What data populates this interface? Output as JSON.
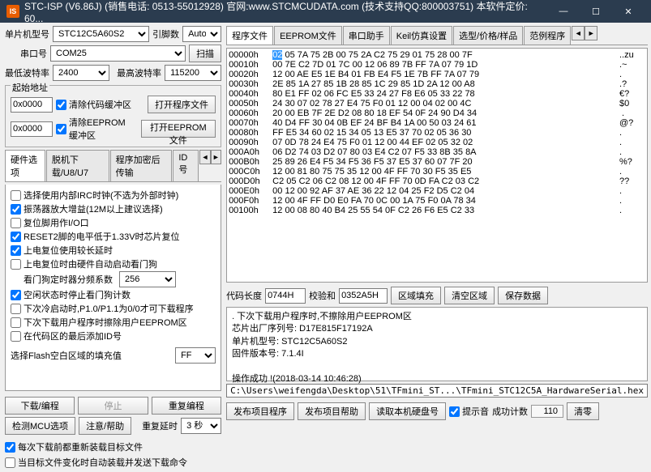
{
  "titlebar": {
    "text": "STC-ISP (V6.86J) (销售电话: 0513-55012928) 官网:www.STCMCUDATA.com (技术支持QQ:800003751) 本软件定价: 60..."
  },
  "left": {
    "mcu_label": "单片机型号",
    "mcu_value": "STC12C5A60S2",
    "pins_label": "引脚数",
    "pins_value": "Auto",
    "port_label": "串口号",
    "port_value": "COM25",
    "scan_btn": "扫描",
    "minbaud_label": "最低波特率",
    "minbaud_value": "2400",
    "maxbaud_label": "最高波特率",
    "maxbaud_value": "115200",
    "start_addr_title": "起始地址",
    "addr1": "0x0000",
    "clear_code": "清除代码缓冲区",
    "open_code": "打开程序文件",
    "addr2": "0x0000",
    "clear_eeprom": "清除EEPROM缓冲区",
    "open_eeprom": "打开EEPROM文件",
    "tabs": [
      "硬件选项",
      "脱机下载/U8/U7",
      "程序加密后传输",
      "ID号"
    ],
    "options": [
      {
        "c": false,
        "t": "选择使用内部IRC时钟(不选为外部时钟)"
      },
      {
        "c": true,
        "t": "振荡器放大增益(12M以上建议选择)"
      },
      {
        "c": false,
        "t": "复位脚用作I/O口"
      },
      {
        "c": true,
        "t": "RESET2脚的电平低于1.33V时芯片复位"
      },
      {
        "c": true,
        "t": "上电复位使用较长延时"
      },
      {
        "c": false,
        "t": "上电复位时由硬件自动启动看门狗"
      }
    ],
    "wdt_label": "看门狗定时器分频系数",
    "wdt_value": "256",
    "idle_stop": "空闲状态时停止看门狗计数",
    "next_cold": "下次冷启动时,P1.0/P1.1为0/0才可下载程序",
    "next_dl": "下次下载用户程序时擦除用户EEPROM区",
    "add_id": "在代码区的最后添加ID号",
    "fill_label": "选择Flash空白区域的填充值",
    "fill_value": "FF",
    "download_btn": "下载/编程",
    "stop_btn": "停止",
    "repeat_btn": "重复编程",
    "detect_btn": "检测MCU选项",
    "help_btn": "注意/帮助",
    "repeat_delay_label": "重复延时",
    "repeat_delay_value": "3 秒",
    "reload_chk": "每次下载前都重新装载目标文件",
    "auto_chk": "当目标文件变化时自动装载并发送下载命令"
  },
  "right": {
    "tabs": [
      "程序文件",
      "EEPROM文件",
      "串口助手",
      "Keil仿真设置",
      "选型/价格/样品",
      "范例程序"
    ],
    "hex": [
      {
        "a": "00000h",
        "b": "02 05 7A 75 2B 00 75 2A C2 75 29 01 75 28 00 7F",
        "s": "..zu",
        "sel": 0
      },
      {
        "a": "00010h",
        "b": "00 7E C2 7D 01 7C 00 12 06 89 7B FF 7A 07 79 1D",
        "s": ".~"
      },
      {
        "a": "00020h",
        "b": "12 00 AE E5 1E B4 01 FB E4 F5 1E 7B FF 7A 07 79",
        "s": "."
      },
      {
        "a": "00030h",
        "b": "2E 85 1A 27 85 1B 28 85 1C 29 85 1D 2A 12 00 A8",
        "s": ".?"
      },
      {
        "a": "00040h",
        "b": "80 E1 FF 02 06 FC E5 33 24 27 F8 E6 05 33 22 78",
        "s": "€?"
      },
      {
        "a": "00050h",
        "b": "24 30 07 02 78 27 E4 75 F0 01 12 00 04 02 00 4C",
        "s": "$0"
      },
      {
        "a": "00060h",
        "b": "20 00 EB 7F 2E D2 08 80 18 EF 54 0F 24 90 D4 34",
        "s": " ."
      },
      {
        "a": "00070h",
        "b": "40 D4 FF 30 04 0B EF 24 BF B4 1A 00 50 03 24 61",
        "s": "@?"
      },
      {
        "a": "00080h",
        "b": "FF E5 34 60 02 15 34 05 13 E5 37 70 02 05 36 30",
        "s": "."
      },
      {
        "a": "00090h",
        "b": "07 0D 78 24 E4 75 F0 01 12 00 44 EF 02 05 32 02",
        "s": "."
      },
      {
        "a": "000A0h",
        "b": "06 D2 74 03 D2 07 80 03 E4 C2 07 F5 33 8B 35 8A",
        "s": "."
      },
      {
        "a": "000B0h",
        "b": "25 89 26 E4 F5 34 F5 36 F5 37 E5 37 60 07 7F 20",
        "s": "%?"
      },
      {
        "a": "000C0h",
        "b": "12 00 81 80 75 75 35 12 00 4F FF 70 30 F5 35 E5",
        "s": "."
      },
      {
        "a": "000D0h",
        "b": "C2 05 C2 06 C2 08 12 00 4F FF 70 0D FA C2 03 C2",
        "s": "??"
      },
      {
        "a": "000E0h",
        "b": "00 12 00 92 AF 37 AE 36 22 12 04 25 F2 D5 C2 04",
        "s": "."
      },
      {
        "a": "000F0h",
        "b": "12 00 4F FF D0 E0 FA 70 0C 00 1A 75 F0 0A 78 34",
        "s": "."
      },
      {
        "a": "00100h",
        "b": "12 00 08 80 40 B4 25 55 54 0F C2 26 F6 E5 C2 33",
        "s": "."
      }
    ],
    "code_len_label": "代码长度",
    "code_len_value": "0744H",
    "checksum_label": "校验和",
    "checksum_value": "0352A5H",
    "fill_btn": "区域填充",
    "clear_btn": "清空区域",
    "save_btn": "保存数据",
    "output_lines": [
      ". 下次下载用户程序时,不擦除用户EEPROM区",
      "芯片出厂序列号: D17E815F17192A",
      "单片机型号: STC12C5A60S2",
      "固件版本号: 7.1.4I",
      "",
      "操作成功 !(2018-03-14 10:46:28)"
    ],
    "file_path": "C:\\Users\\weifengda\\Desktop\\51\\TFmini_ST...\\TFmini_STC12C5A_HardwareSerial.hex",
    "publish_btn": "发布项目程序",
    "help2_btn": "发布项目帮助",
    "read_btn": "读取本机硬盘号",
    "hint_chk": "提示音",
    "success_label": "成功计数",
    "success_value": "110",
    "zero_btn": "清零"
  }
}
